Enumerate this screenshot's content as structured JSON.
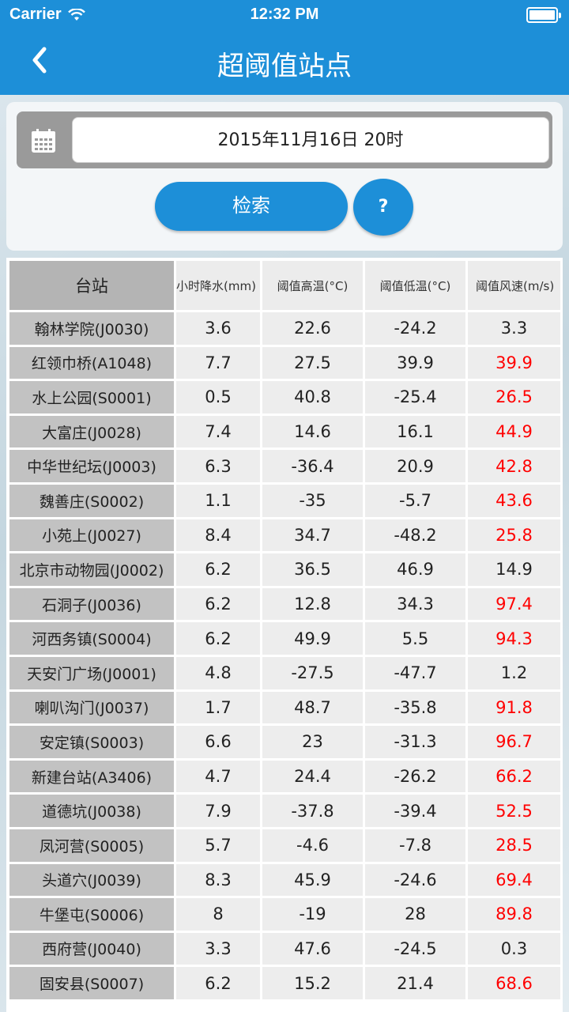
{
  "status_bar": {
    "carrier": "Carrier",
    "time": "12:32 PM"
  },
  "nav": {
    "title": "超阈值站点",
    "back_icon": "chevron-left-icon"
  },
  "search_panel": {
    "calendar_icon": "calendar-icon",
    "date_value": "2015年11月16日 20时",
    "search_label": "检索",
    "help_label": "?"
  },
  "table": {
    "headers": [
      "台站",
      "小时降水(mm)",
      "阈值高温(°C)",
      "阈值低温(°C)",
      "阈值风速(m/s)"
    ],
    "rows": [
      {
        "station": "翰林学院(J0030)",
        "rain": "3.6",
        "high": "22.6",
        "low": "-24.2",
        "wind": "3.3",
        "wind_alert": false
      },
      {
        "station": "红领巾桥(A1048)",
        "rain": "7.7",
        "high": "27.5",
        "low": "39.9",
        "wind": "39.9",
        "wind_alert": true
      },
      {
        "station": "水上公园(S0001)",
        "rain": "0.5",
        "high": "40.8",
        "low": "-25.4",
        "wind": "26.5",
        "wind_alert": true
      },
      {
        "station": "大富庄(J0028)",
        "rain": "7.4",
        "high": "14.6",
        "low": "16.1",
        "wind": "44.9",
        "wind_alert": true
      },
      {
        "station": "中华世纪坛(J0003)",
        "rain": "6.3",
        "high": "-36.4",
        "low": "20.9",
        "wind": "42.8",
        "wind_alert": true
      },
      {
        "station": "魏善庄(S0002)",
        "rain": "1.1",
        "high": "-35",
        "low": "-5.7",
        "wind": "43.6",
        "wind_alert": true
      },
      {
        "station": "小苑上(J0027)",
        "rain": "8.4",
        "high": "34.7",
        "low": "-48.2",
        "wind": "25.8",
        "wind_alert": true
      },
      {
        "station": "北京市动物园(J0002)",
        "rain": "6.2",
        "high": "36.5",
        "low": "46.9",
        "wind": "14.9",
        "wind_alert": false
      },
      {
        "station": "石洞子(J0036)",
        "rain": "6.2",
        "high": "12.8",
        "low": "34.3",
        "wind": "97.4",
        "wind_alert": true
      },
      {
        "station": "河西务镇(S0004)",
        "rain": "6.2",
        "high": "49.9",
        "low": "5.5",
        "wind": "94.3",
        "wind_alert": true
      },
      {
        "station": "天安门广场(J0001)",
        "rain": "4.8",
        "high": "-27.5",
        "low": "-47.7",
        "wind": "1.2",
        "wind_alert": false
      },
      {
        "station": "喇叭沟门(J0037)",
        "rain": "1.7",
        "high": "48.7",
        "low": "-35.8",
        "wind": "91.8",
        "wind_alert": true
      },
      {
        "station": "安定镇(S0003)",
        "rain": "6.6",
        "high": "23",
        "low": "-31.3",
        "wind": "96.7",
        "wind_alert": true
      },
      {
        "station": "新建台站(A3406)",
        "rain": "4.7",
        "high": "24.4",
        "low": "-26.2",
        "wind": "66.2",
        "wind_alert": true
      },
      {
        "station": "道德坑(J0038)",
        "rain": "7.9",
        "high": "-37.8",
        "low": "-39.4",
        "wind": "52.5",
        "wind_alert": true
      },
      {
        "station": "凤河营(S0005)",
        "rain": "5.7",
        "high": "-4.6",
        "low": "-7.8",
        "wind": "28.5",
        "wind_alert": true
      },
      {
        "station": "头道穴(J0039)",
        "rain": "8.3",
        "high": "45.9",
        "low": "-24.6",
        "wind": "69.4",
        "wind_alert": true
      },
      {
        "station": "牛堡屯(S0006)",
        "rain": "8",
        "high": "-19",
        "low": "28",
        "wind": "89.8",
        "wind_alert": true
      },
      {
        "station": "西府营(J0040)",
        "rain": "3.3",
        "high": "47.6",
        "low": "-24.5",
        "wind": "0.3",
        "wind_alert": false
      },
      {
        "station": "固安县(S0007)",
        "rain": "6.2",
        "high": "15.2",
        "low": "21.4",
        "wind": "68.6",
        "wind_alert": true
      }
    ]
  },
  "colors": {
    "primary": "#1d8fd8",
    "alert": "#ff0000"
  }
}
